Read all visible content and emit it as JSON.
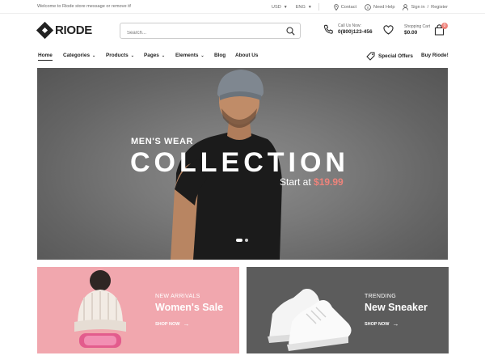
{
  "topbar": {
    "message": "Welcome to Riode store message or remove it!",
    "currency": "USD",
    "language": "ENG",
    "contact": "Contact",
    "help": "Need Help",
    "signin": "Sign in",
    "slash": "/",
    "register": "Register"
  },
  "header": {
    "logo": "RIODE",
    "search_placeholder": "Search...",
    "call_label": "Call Us Now:",
    "call_number": "0(800)123-456",
    "cart_label": "Shopping Cart",
    "cart_total": "$0.00",
    "cart_count": "0"
  },
  "nav": {
    "items": [
      {
        "label": "Home"
      },
      {
        "label": "Categories"
      },
      {
        "label": "Products"
      },
      {
        "label": "Pages"
      },
      {
        "label": "Elements"
      },
      {
        "label": "Blog"
      },
      {
        "label": "About Us"
      }
    ],
    "special": "Special Offers",
    "buy": "Buy Riode!"
  },
  "hero": {
    "overline": "MEN'S WEAR",
    "title": "COLLECTION",
    "sub_prefix": "Start at",
    "price": "$19.99",
    "slide_count": 2,
    "active_slide": 1
  },
  "banners": [
    {
      "overline": "NEW ARRIVALS",
      "title": "Women's Sale",
      "cta": "SHOP NOW"
    },
    {
      "overline": "TRENDING",
      "title": "New Sneaker",
      "cta": "SHOP NOW"
    }
  ],
  "colors": {
    "accent": "#ef837b",
    "dark": "#222222",
    "pink_banner": "#f1a7ae",
    "gray_banner": "#5c5c5c"
  }
}
